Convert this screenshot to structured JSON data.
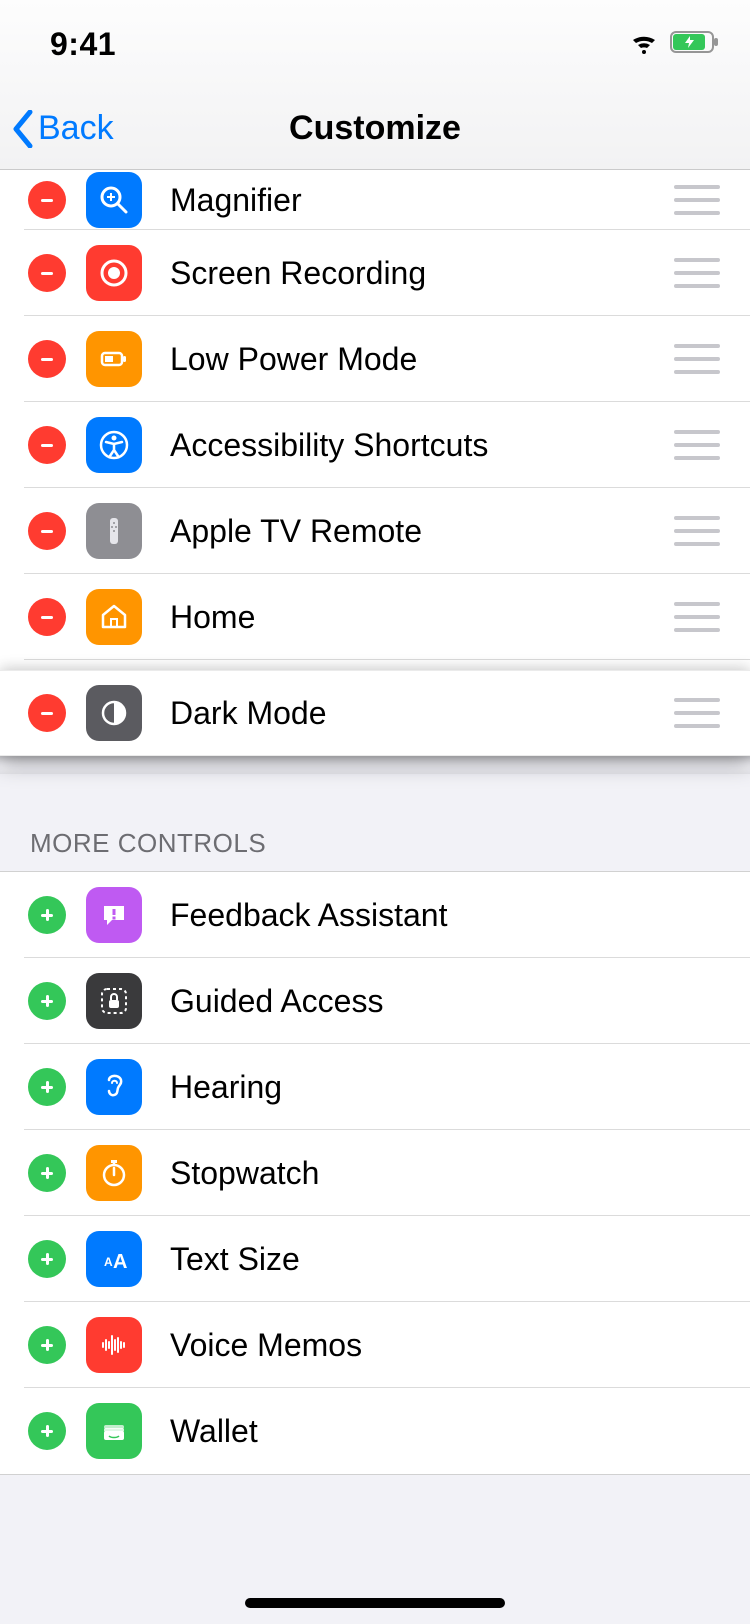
{
  "statusbar": {
    "time": "9:41"
  },
  "nav": {
    "back": "Back",
    "title": "Customize"
  },
  "included": [
    {
      "id": "magnifier",
      "label": "Magnifier",
      "icon": "magnifier",
      "color": "ic-blue"
    },
    {
      "id": "screen-recording",
      "label": "Screen Recording",
      "icon": "record",
      "color": "ic-red"
    },
    {
      "id": "low-power",
      "label": "Low Power Mode",
      "icon": "battery",
      "color": "ic-orange"
    },
    {
      "id": "accessibility",
      "label": "Accessibility Shortcuts",
      "icon": "accessibility",
      "color": "ic-blue"
    },
    {
      "id": "tv-remote",
      "label": "Apple TV Remote",
      "icon": "remote",
      "color": "ic-gray"
    },
    {
      "id": "home",
      "label": "Home",
      "icon": "home",
      "color": "ic-orange"
    },
    {
      "id": "dark-mode",
      "label": "Dark Mode",
      "icon": "darkmode",
      "color": "ic-darkgray",
      "lifted": true
    }
  ],
  "more_header": "MORE CONTROLS",
  "more": [
    {
      "id": "feedback",
      "label": "Feedback Assistant",
      "icon": "feedback",
      "color": "ic-purple"
    },
    {
      "id": "guided-access",
      "label": "Guided Access",
      "icon": "lock-dashed",
      "color": "ic-charcoal"
    },
    {
      "id": "hearing",
      "label": "Hearing",
      "icon": "ear",
      "color": "ic-blue"
    },
    {
      "id": "stopwatch",
      "label": "Stopwatch",
      "icon": "stopwatch",
      "color": "ic-orange"
    },
    {
      "id": "text-size",
      "label": "Text Size",
      "icon": "textsize",
      "color": "ic-blue"
    },
    {
      "id": "voice-memos",
      "label": "Voice Memos",
      "icon": "waveform",
      "color": "ic-red"
    },
    {
      "id": "wallet",
      "label": "Wallet",
      "icon": "wallet",
      "color": "ic-green"
    }
  ]
}
